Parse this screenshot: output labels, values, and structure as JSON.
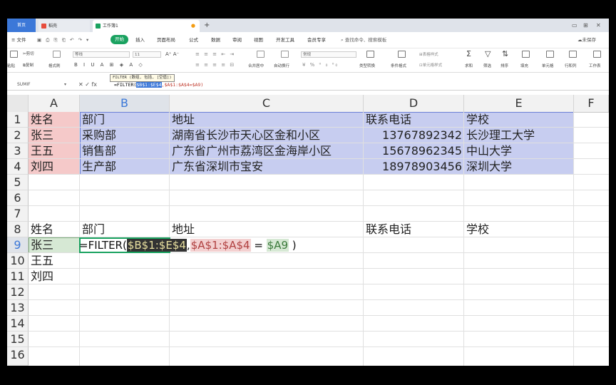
{
  "tabs": {
    "home": "首页",
    "shell": "稻壳",
    "workbook": "工作簿1",
    "add": "+"
  },
  "window_controls": {
    "layout": "▭",
    "grid": "⊞",
    "close": "✕"
  },
  "menu": {
    "file": "≡ 文件",
    "items": [
      "开始",
      "插入",
      "页面布局",
      "公式",
      "数据",
      "审阅",
      "视图",
      "开发工具",
      "会员专享"
    ],
    "search": "查找命令、搜索模板",
    "save_state": "未保存"
  },
  "ribbon": {
    "cut": "剪切",
    "paste": "粘贴",
    "copy": "复制",
    "format_painter": "格式刷",
    "font_name": "等线",
    "font_size": "11",
    "merge": "合并居中",
    "wrap": "自动换行",
    "number_format": "常规",
    "type_convert": "类型转换",
    "cond_format": "条件格式",
    "cell_style": "单元格样式",
    "table_style": "表格样式",
    "sum": "求和",
    "filter": "筛选",
    "sort": "排序",
    "fill": "填充",
    "cell": "单元格",
    "row_col": "行和列",
    "worksheet": "工作表"
  },
  "formula_bar": {
    "name_box": "SUMIF",
    "icons": "✕ ✓ fx",
    "prefix": "=FILTER(",
    "arg1": "$B$1:$E$4",
    "rest": ",$A$1:$A$4=$A9)",
    "tooltip": "FILTER (数组, 包括, [空值])"
  },
  "columns": [
    "A",
    "B",
    "C",
    "D",
    "E",
    "F"
  ],
  "rows": [
    "1",
    "2",
    "3",
    "4",
    "5",
    "6",
    "7",
    "8",
    "9",
    "10",
    "11",
    "12",
    "13",
    "14",
    "15",
    "16"
  ],
  "table1": {
    "header": [
      "姓名",
      "部门",
      "地址",
      "联系电话",
      "学校"
    ],
    "data": [
      [
        "张三",
        "采购部",
        "湖南省长沙市天心区金和小区",
        "13767892342",
        "长沙理工大学"
      ],
      [
        "王五",
        "销售部",
        "广东省广州市荔湾区金海岸小区",
        "15678962345",
        "中山大学"
      ],
      [
        "刘四",
        "生产部",
        "广东省深圳市宝安",
        "18978903456",
        "深圳大学"
      ]
    ]
  },
  "table2": {
    "header": [
      "姓名",
      "部门",
      "地址",
      "联系电话",
      "学校"
    ],
    "names": [
      "张三",
      "王五",
      "刘四"
    ]
  },
  "editing": {
    "eq": "=FILTER(",
    "arg1": "$B$1:$E$4",
    "comma": ",",
    "arg2": "$A$1:$A$4",
    "op": " = ",
    "arg3": "$A9",
    "close": " )"
  },
  "colors": {
    "accent_green": "#1aa260",
    "tab_blue": "#3c78d8",
    "range_blue": "#c7cdf0",
    "range_red": "#f5c9c9"
  }
}
